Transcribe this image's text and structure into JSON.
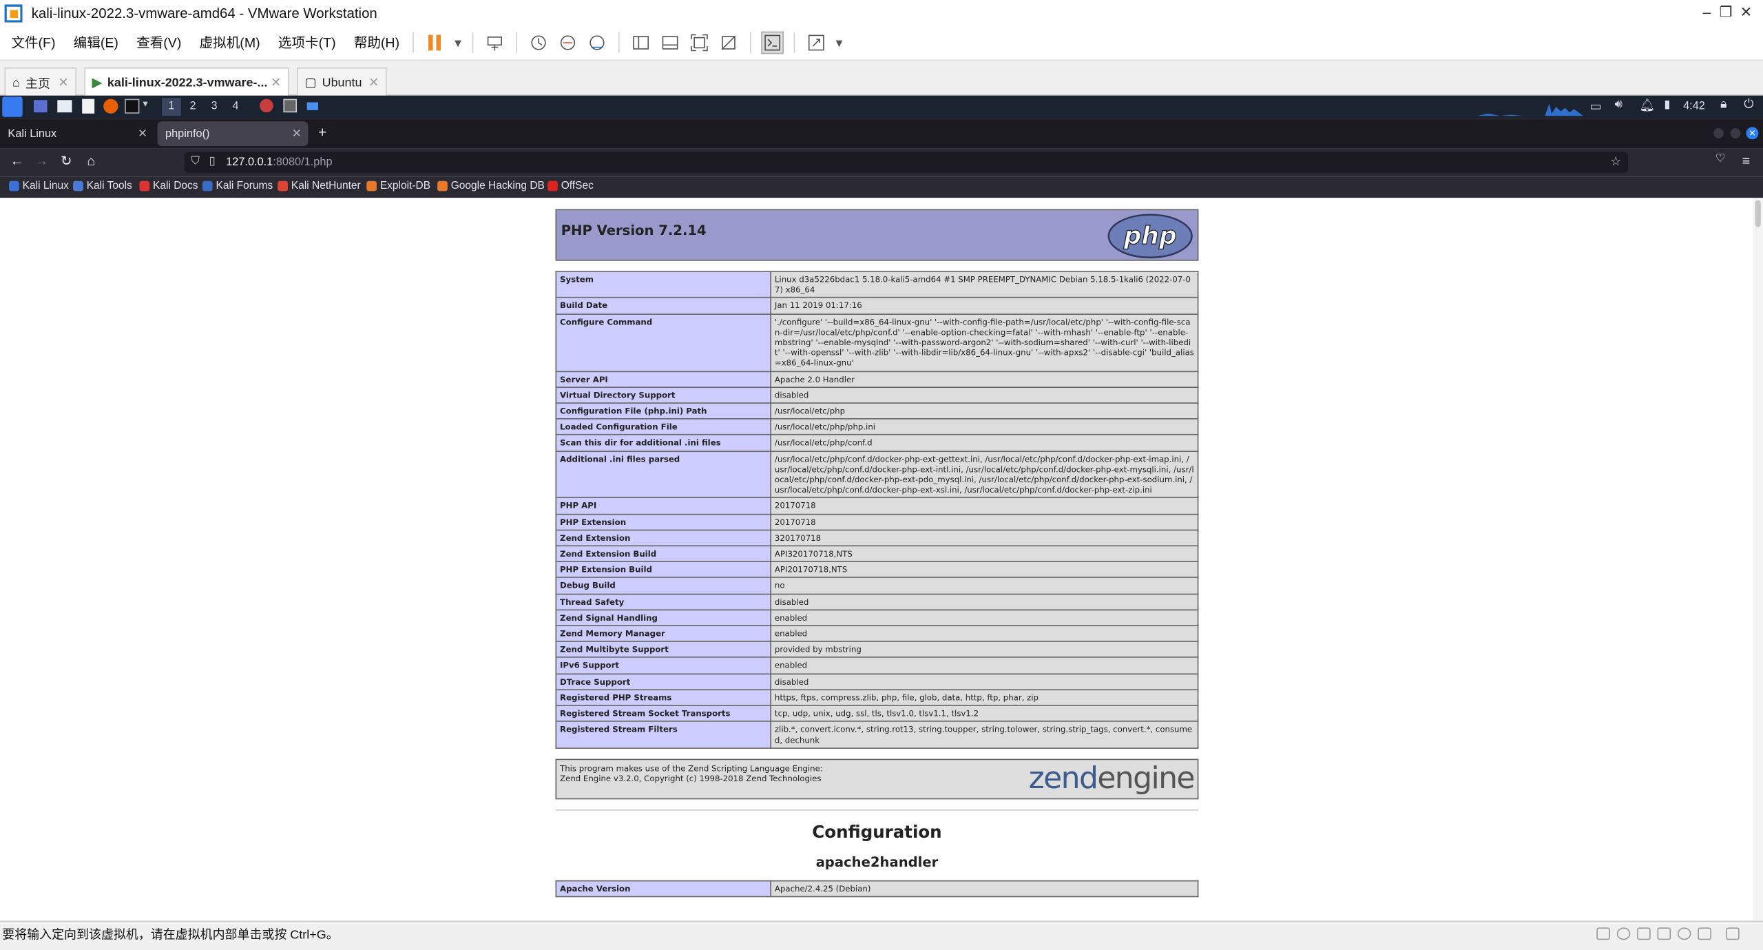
{
  "window": {
    "title": "kali-linux-2022.3-vmware-amd64 - VMware Workstation"
  },
  "menu": [
    "文件(F)",
    "编辑(E)",
    "查看(V)",
    "虚拟机(M)",
    "选项卡(T)",
    "帮助(H)"
  ],
  "vm_tabs": [
    {
      "label": "主页",
      "icon": "home-icon"
    },
    {
      "label": "kali-linux-2022.3-vmware-...",
      "icon": "vm-running-icon"
    },
    {
      "label": "Ubuntu",
      "icon": "vm-icon"
    }
  ],
  "kali_panel": {
    "workspaces": [
      "1",
      "2",
      "3",
      "4"
    ],
    "clock": "4:42"
  },
  "firefox": {
    "tabs": [
      "Kali Linux",
      "phpinfo()"
    ],
    "url_host": "127.0.0.1",
    "url_rest": ":8080/1.php",
    "bookmarks": [
      "Kali Linux",
      "Kali Tools",
      "Kali Docs",
      "Kali Forums",
      "Kali NetHunter",
      "Exploit-DB",
      "Google Hacking DB",
      "OffSec"
    ]
  },
  "phpinfo": {
    "version_title": "PHP Version 7.2.14",
    "rows": [
      [
        "System",
        "Linux d3a5226bdac1 5.18.0-kali5-amd64 #1 SMP PREEMPT_DYNAMIC Debian 5.18.5-1kali6 (2022-07-07) x86_64"
      ],
      [
        "Build Date",
        "Jan 11 2019 01:17:16"
      ],
      [
        "Configure Command",
        "'./configure' '--build=x86_64-linux-gnu' '--with-config-file-path=/usr/local/etc/php' '--with-config-file-scan-dir=/usr/local/etc/php/conf.d' '--enable-option-checking=fatal' '--with-mhash' '--enable-ftp' '--enable-mbstring' '--enable-mysqlnd' '--with-password-argon2' '--with-sodium=shared' '--with-curl' '--with-libedit' '--with-openssl' '--with-zlib' '--with-libdir=lib/x86_64-linux-gnu' '--with-apxs2' '--disable-cgi' 'build_alias=x86_64-linux-gnu'"
      ],
      [
        "Server API",
        "Apache 2.0 Handler"
      ],
      [
        "Virtual Directory Support",
        "disabled"
      ],
      [
        "Configuration File (php.ini) Path",
        "/usr/local/etc/php"
      ],
      [
        "Loaded Configuration File",
        "/usr/local/etc/php/php.ini"
      ],
      [
        "Scan this dir for additional .ini files",
        "/usr/local/etc/php/conf.d"
      ],
      [
        "Additional .ini files parsed",
        "/usr/local/etc/php/conf.d/docker-php-ext-gettext.ini, /usr/local/etc/php/conf.d/docker-php-ext-imap.ini, /usr/local/etc/php/conf.d/docker-php-ext-intl.ini, /usr/local/etc/php/conf.d/docker-php-ext-mysqli.ini, /usr/local/etc/php/conf.d/docker-php-ext-pdo_mysql.ini, /usr/local/etc/php/conf.d/docker-php-ext-sodium.ini, /usr/local/etc/php/conf.d/docker-php-ext-xsl.ini, /usr/local/etc/php/conf.d/docker-php-ext-zip.ini"
      ],
      [
        "PHP API",
        "20170718"
      ],
      [
        "PHP Extension",
        "20170718"
      ],
      [
        "Zend Extension",
        "320170718"
      ],
      [
        "Zend Extension Build",
        "API320170718,NTS"
      ],
      [
        "PHP Extension Build",
        "API20170718,NTS"
      ],
      [
        "Debug Build",
        "no"
      ],
      [
        "Thread Safety",
        "disabled"
      ],
      [
        "Zend Signal Handling",
        "enabled"
      ],
      [
        "Zend Memory Manager",
        "enabled"
      ],
      [
        "Zend Multibyte Support",
        "provided by mbstring"
      ],
      [
        "IPv6 Support",
        "enabled"
      ],
      [
        "DTrace Support",
        "disabled"
      ],
      [
        "Registered PHP Streams",
        "https, ftps, compress.zlib, php, file, glob, data, http, ftp, phar, zip"
      ],
      [
        "Registered Stream Socket Transports",
        "tcp, udp, unix, udg, ssl, tls, tlsv1.0, tlsv1.1, tlsv1.2"
      ],
      [
        "Registered Stream Filters",
        "zlib.*, convert.iconv.*, string.rot13, string.toupper, string.tolower, string.strip_tags, convert.*, consumed, dechunk"
      ]
    ],
    "zend_line1": "This program makes use of the Zend Scripting Language Engine:",
    "zend_line2": "Zend Engine v3.2.0, Copyright (c) 1998-2018 Zend Technologies",
    "zend_logo_a": "zend",
    "zend_logo_b": "engine",
    "php_logo": "php",
    "configuration_heading": "Configuration",
    "module_heading": "apache2handler",
    "apache_row": [
      "Apache Version",
      "Apache/2.4.25 (Debian)"
    ]
  },
  "status_bar": {
    "text": "要将输入定向到该虚拟机，请在虚拟机内部单击或按 Ctrl+G。"
  }
}
